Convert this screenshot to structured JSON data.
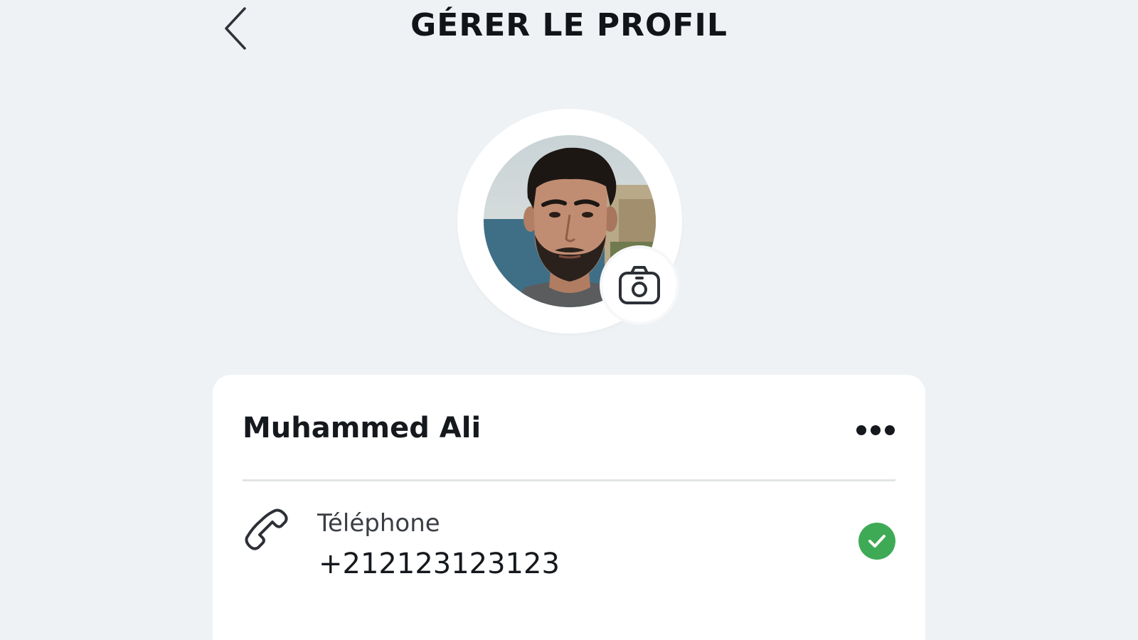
{
  "header": {
    "title": "GÉRER LE PROFIL",
    "back_icon": "chevron-left-icon"
  },
  "avatar": {
    "alt": "Photo de profil",
    "edit_icon": "camera-icon"
  },
  "profile": {
    "name": "Muhammed Ali",
    "more_icon": "more-horizontal-icon"
  },
  "contact": {
    "phone_label": "Téléphone",
    "phone_value": "+21212312312​3",
    "phone_icon": "phone-icon",
    "status_icon": "check-circle-icon",
    "status_color": "#3faa55"
  },
  "colors": {
    "background": "#eff2f5",
    "card": "#ffffff",
    "text": "#15181c"
  }
}
